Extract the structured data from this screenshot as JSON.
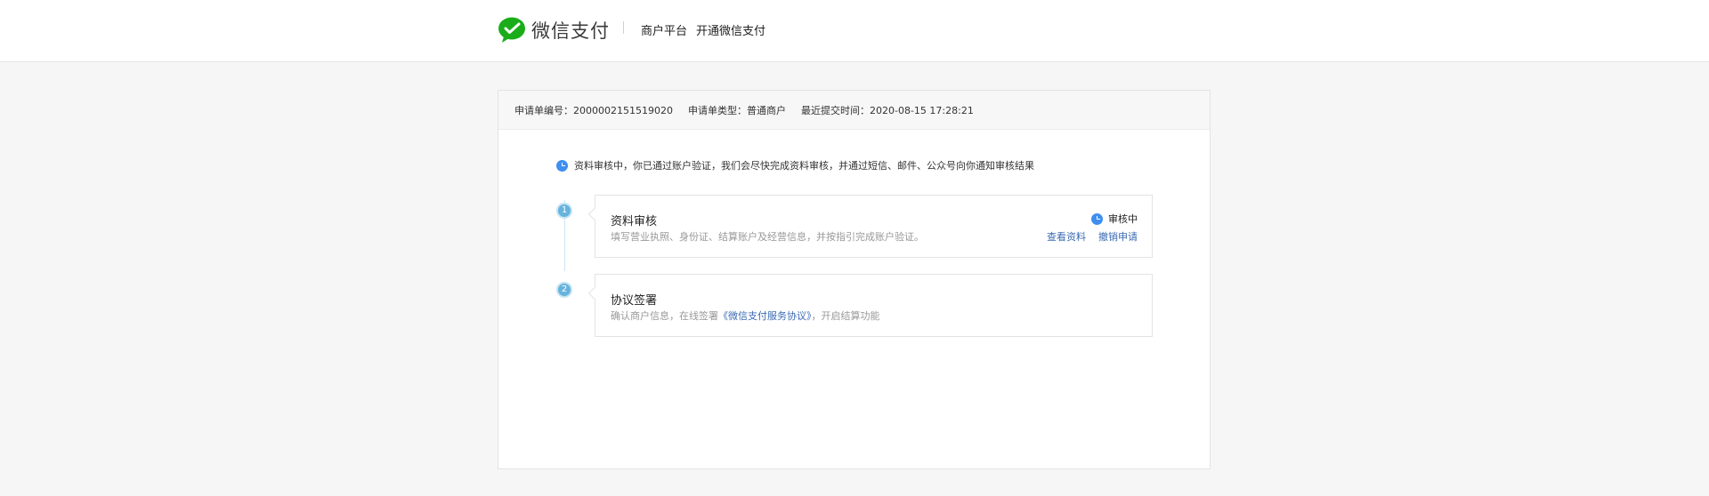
{
  "header": {
    "brand_name": "微信支付",
    "nav": [
      "商户平台",
      "开通微信支付"
    ]
  },
  "application": {
    "number_label": "申请单编号：",
    "number_value": "2000002151519020",
    "type_label": "申请单类型：",
    "type_value": "普通商户",
    "time_label": "最近提交时间：",
    "time_value": "2020-08-15 17:28:21"
  },
  "notice": "资料审核中，你已通过账户验证，我们会尽快完成资料审核，并通过短信、邮件、公众号向你通知审核结果",
  "steps": [
    {
      "number": "1",
      "title": "资料审核",
      "desc": "填写营业执照、身份证、结算账户及经营信息，并按指引完成账户验证。",
      "status": "审核中",
      "actions": [
        "查看资料",
        "撤销申请"
      ]
    },
    {
      "number": "2",
      "title": "协议签署",
      "desc_before": "确认商户信息，在线签署",
      "desc_link": "《微信支付服务协议》",
      "desc_after": "，开启结算功能"
    }
  ],
  "colors": {
    "brand_green": "#1aad19",
    "link_blue": "#3b6ab2",
    "status_blue": "#3f8ef0",
    "step_blue": "#66b3dd"
  },
  "icons": {
    "brand": "wechat-pay-logo",
    "status": "clock-icon"
  }
}
